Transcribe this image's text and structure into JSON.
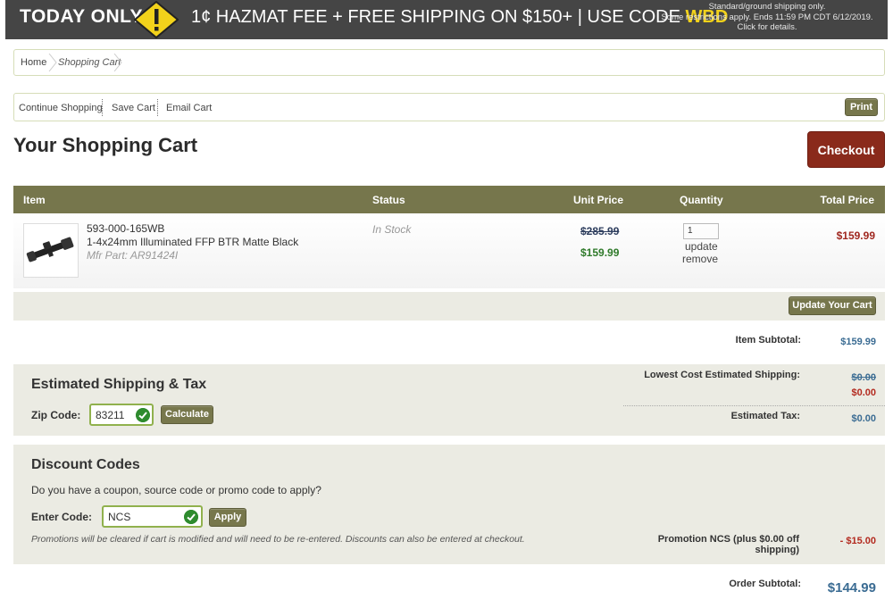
{
  "promo": {
    "today_only": "TODAY ONLY",
    "message": "1¢ HAZMAT FEE + FREE SHIPPING ON $150+ | USE CODE ",
    "code": "WBD",
    "fine_print_1": "Standard/ground shipping only.",
    "fine_print_2": "Some restrictions apply. Ends 11:59 PM CDT 6/12/2019.",
    "fine_print_3": "Click for details.",
    "accent_color": "#f2d21b"
  },
  "breadcrumb": {
    "home": "Home",
    "current": "Shopping Cart"
  },
  "actions": {
    "continue": "Continue Shopping",
    "save": "Save Cart",
    "email": "Email Cart",
    "print": "Print"
  },
  "page": {
    "title": "Your Shopping Cart",
    "checkout": "Checkout"
  },
  "table": {
    "headers": {
      "item": "Item",
      "status": "Status",
      "unit_price": "Unit Price",
      "quantity": "Quantity",
      "total_price": "Total Price"
    },
    "rows": [
      {
        "sku": "593-000-165WB",
        "name": "1-4x24mm Illuminated FFP BTR Matte Black",
        "mfr_part": "Mfr Part: AR91424I",
        "status": "In Stock",
        "old_price": "$285.99",
        "new_price": "$159.99",
        "quantity": "1",
        "update": "update",
        "remove": "remove",
        "total": "$159.99",
        "image_icon": "rifle-scope-icon"
      }
    ]
  },
  "update_cart": "Update Your Cart",
  "subtotals": {
    "item_subtotal_label": "Item Subtotal:",
    "item_subtotal": "$159.99",
    "shipping_label": "Lowest Cost Estimated Shipping:",
    "shipping_old": "$0.00",
    "shipping_new": "$0.00",
    "tax_label": "Estimated Tax:",
    "tax": "$0.00",
    "promo_label": "Promotion NCS (plus $0.00 off shipping)",
    "promo_value": "- $15.00",
    "order_subtotal_label": "Order Subtotal:",
    "order_subtotal": "$144.99"
  },
  "shipping": {
    "heading": "Estimated Shipping & Tax",
    "zip_label": "Zip Code:",
    "zip_value": "83211",
    "calculate": "Calculate"
  },
  "discount": {
    "heading": "Discount Codes",
    "question": "Do you have a coupon, source code or promo code to apply?",
    "enter_label": "Enter Code:",
    "code_value": "NCS",
    "apply": "Apply",
    "note": "Promotions will be cleared if cart is modified and will need to be re-entered. Discounts can also be entered at checkout."
  }
}
